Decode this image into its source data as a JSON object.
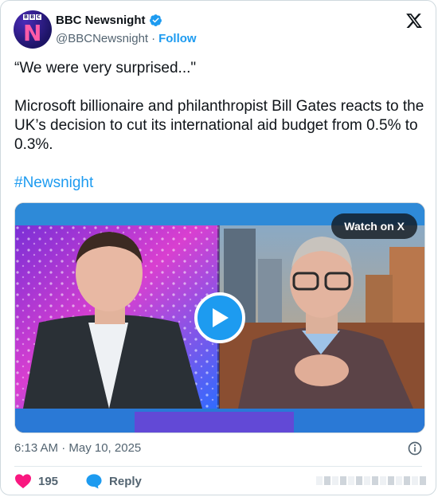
{
  "account": {
    "display_name": "BBC Newsnight",
    "handle": "@BBCNewsnight",
    "separator": "·",
    "follow_label": "Follow",
    "avatar_logo": "BBC",
    "avatar_letter": "N",
    "verified_icon": "verified-badge-icon"
  },
  "tweet": {
    "quote": "“We were very surprised...\"",
    "body": "Microsoft billionaire and philanthropist Bill Gates reacts to the UK’s decision to cut its international aid budget from 0.5% to 0.3%.",
    "hashtag": "#Newsnight"
  },
  "media": {
    "watch_label": "Watch on X",
    "play_icon": "play-icon"
  },
  "meta": {
    "timestamp": "6:13 AM · May 10, 2025",
    "info_icon": "info-icon"
  },
  "actions": {
    "like_count": "195",
    "reply_label": "Reply",
    "like_icon": "heart-icon",
    "reply_icon": "reply-bubble-icon"
  },
  "colors": {
    "accent": "#1d9bf0",
    "like": "#f91880",
    "text": "#0f1419",
    "muted": "#536471"
  }
}
